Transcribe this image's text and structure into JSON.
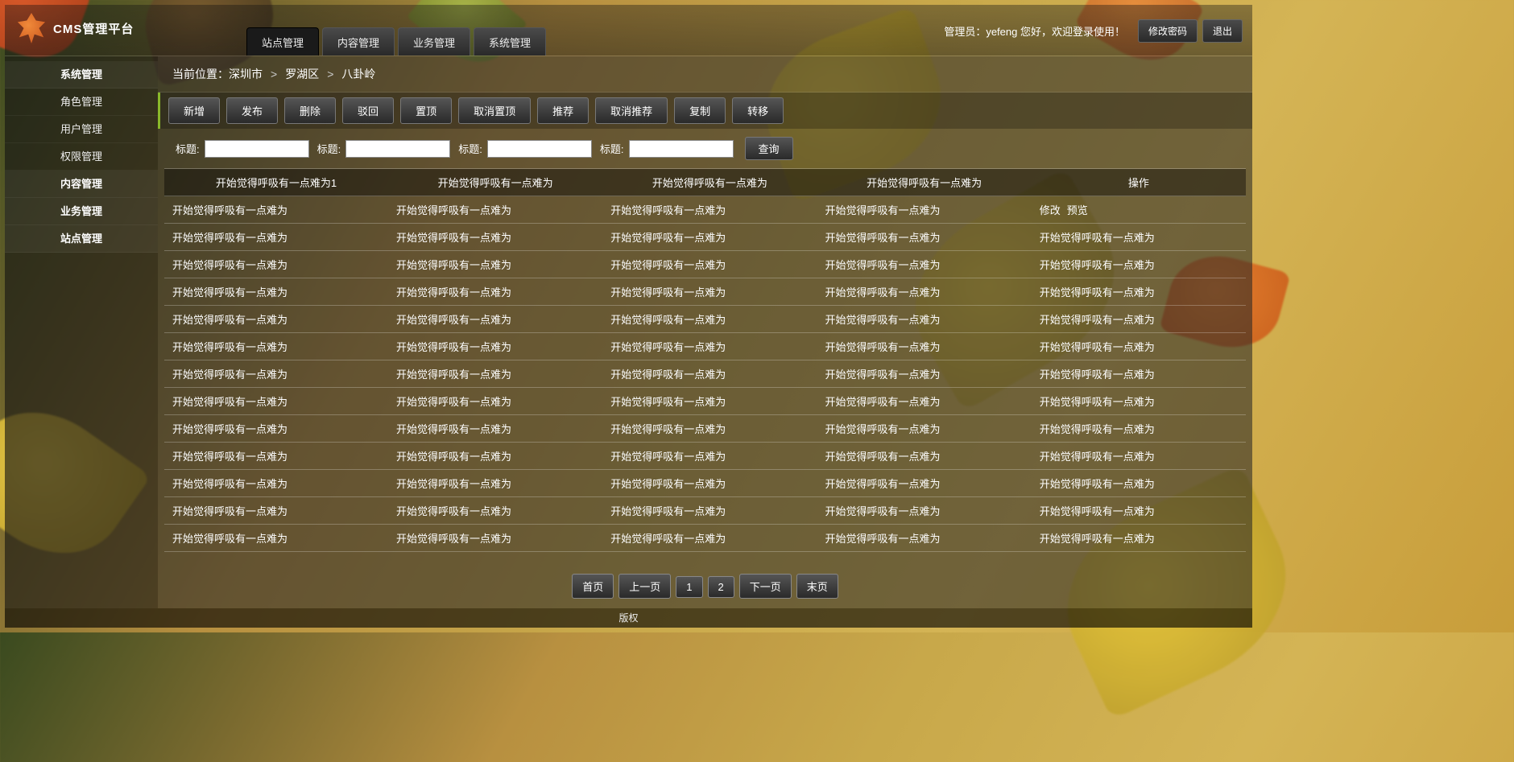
{
  "app": {
    "title": "CMS管理平台"
  },
  "user": {
    "greeting": "管理员：yefeng 您好，欢迎登录使用！",
    "change_pwd": "修改密码",
    "logout": "退出"
  },
  "top_tabs": [
    {
      "label": "站点管理",
      "active": true
    },
    {
      "label": "内容管理",
      "active": false
    },
    {
      "label": "业务管理",
      "active": false
    },
    {
      "label": "系统管理",
      "active": false
    }
  ],
  "sidebar": [
    {
      "label": "系统管理",
      "group": true
    },
    {
      "label": "角色管理",
      "group": false
    },
    {
      "label": "用户管理",
      "group": false
    },
    {
      "label": "权限管理",
      "group": false
    },
    {
      "label": "内容管理",
      "group": true
    },
    {
      "label": "业务管理",
      "group": true
    },
    {
      "label": "站点管理",
      "group": true
    }
  ],
  "breadcrumb": {
    "label": "当前位置：",
    "parts": [
      "深圳市",
      "罗湖区",
      "八卦岭"
    ],
    "sep": ">"
  },
  "toolbar": [
    "新增",
    "发布",
    "删除",
    "驳回",
    "置顶",
    "取消置顶",
    "推荐",
    "取消推荐",
    "复制",
    "转移"
  ],
  "filters": {
    "label": "标题:",
    "query_label": "查询",
    "count": 4
  },
  "table": {
    "headers": [
      "开始觉得呼吸有一点难为1",
      "开始觉得呼吸有一点难为",
      "开始觉得呼吸有一点难为",
      "开始觉得呼吸有一点难为",
      "操作"
    ],
    "cell_text": "开始觉得呼吸有一点难为",
    "row_count": 13,
    "first_row_actions": {
      "edit": "修改",
      "preview": "预览"
    }
  },
  "pager": {
    "first": "首页",
    "prev": "上一页",
    "pages": [
      "1",
      "2"
    ],
    "next": "下一页",
    "last": "末页"
  },
  "footer": {
    "text": "版权"
  }
}
